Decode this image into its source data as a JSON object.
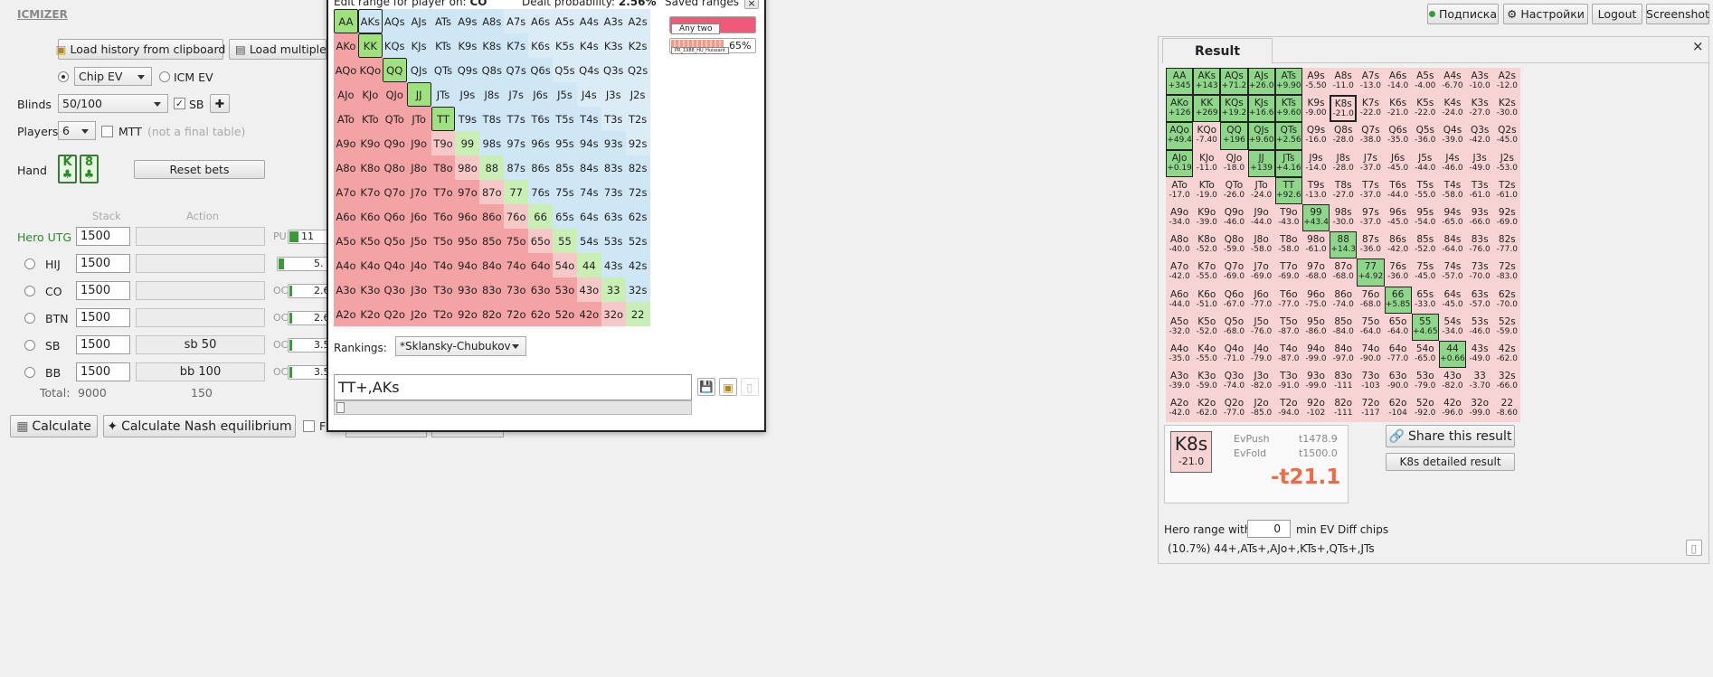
{
  "app": {
    "logo": "ICMIZER"
  },
  "topnav": {
    "subscription": "Подписка",
    "settings": "Настройки",
    "logout": "Logout",
    "screenshot": "Screenshot"
  },
  "left": {
    "load_history": "Load history from clipboard",
    "load_multiple": "Load multiple",
    "ev_mode": "Chip EV",
    "icm_ev": "ICM EV",
    "blinds_label": "Blinds",
    "blinds_value": "50/100",
    "sb_label": "SB",
    "players_label": "Players",
    "players_value": "6",
    "mtt_label": "MTT",
    "mtt_note": "(not a final table)",
    "hand_label": "Hand",
    "card1": "K",
    "card2": "8",
    "reset_bets": "Reset bets",
    "stack_header": "Stack",
    "action_header": "Action",
    "players": [
      {
        "name": "Hero",
        "pos": "UTG",
        "stack": "1500",
        "action": "",
        "chip": "PU",
        "range": "11"
      },
      {
        "name": "HIJ",
        "stack": "1500",
        "action": "",
        "chip": "",
        "range": "5."
      },
      {
        "name": "CO",
        "stack": "1500",
        "action": "",
        "chip": "OC",
        "range": "2.6"
      },
      {
        "name": "BTN",
        "stack": "1500",
        "action": "",
        "chip": "OC",
        "range": "2.6"
      },
      {
        "name": "SB",
        "stack": "1500",
        "action": "sb 50",
        "chip": "OC",
        "range": "3.5"
      },
      {
        "name": "BB",
        "stack": "1500",
        "action": "bb 100",
        "chip": "OC",
        "range": "3.5"
      }
    ],
    "total_label": "Total:",
    "total_stack": "9000",
    "total_action": "150",
    "calculate": "Calculate",
    "nash": "Calculate Nash equilibrium",
    "f_label": "F"
  },
  "editor": {
    "title": "Edit range for player on:",
    "title_pos": "CO",
    "dealt_label": "Dealt probability:",
    "dealt_value": "2.56%",
    "saved_label": "Saved ranges",
    "close": "×",
    "saved_any_two": "Any two",
    "saved_pct": "65%",
    "saved_thumb_caption": "PR_1988_HU_Huissant",
    "rankings_label": "Rankings:",
    "rankings_value": "*Sklansky-Chubukov",
    "range_text": "TT+,AKs"
  },
  "hands": [
    [
      "AA",
      "AKs",
      "AQs",
      "AJs",
      "ATs",
      "A9s",
      "A8s",
      "A7s",
      "A6s",
      "A5s",
      "A4s",
      "A3s",
      "A2s"
    ],
    [
      "AKo",
      "KK",
      "KQs",
      "KJs",
      "KTs",
      "K9s",
      "K8s",
      "K7s",
      "K6s",
      "K5s",
      "K4s",
      "K3s",
      "K2s"
    ],
    [
      "AQo",
      "KQo",
      "QQ",
      "QJs",
      "QTs",
      "Q9s",
      "Q8s",
      "Q7s",
      "Q6s",
      "Q5s",
      "Q4s",
      "Q3s",
      "Q2s"
    ],
    [
      "AJo",
      "KJo",
      "QJo",
      "JJ",
      "JTs",
      "J9s",
      "J8s",
      "J7s",
      "J6s",
      "J5s",
      "J4s",
      "J3s",
      "J2s"
    ],
    [
      "ATo",
      "KTo",
      "QTo",
      "JTo",
      "TT",
      "T9s",
      "T8s",
      "T7s",
      "T6s",
      "T5s",
      "T4s",
      "T3s",
      "T2s"
    ],
    [
      "A9o",
      "K9o",
      "Q9o",
      "J9o",
      "T9o",
      "99",
      "98s",
      "97s",
      "96s",
      "95s",
      "94s",
      "93s",
      "92s"
    ],
    [
      "A8o",
      "K8o",
      "Q8o",
      "J8o",
      "T8o",
      "98o",
      "88",
      "87s",
      "86s",
      "85s",
      "84s",
      "83s",
      "82s"
    ],
    [
      "A7o",
      "K7o",
      "Q7o",
      "J7o",
      "T7o",
      "97o",
      "87o",
      "77",
      "76s",
      "75s",
      "74s",
      "73s",
      "72s"
    ],
    [
      "A6o",
      "K6o",
      "Q6o",
      "J6o",
      "T6o",
      "96o",
      "86o",
      "76o",
      "66",
      "65s",
      "64s",
      "63s",
      "62s"
    ],
    [
      "A5o",
      "K5o",
      "Q5o",
      "J5o",
      "T5o",
      "95o",
      "85o",
      "75o",
      "65o",
      "55",
      "54s",
      "53s",
      "52s"
    ],
    [
      "A4o",
      "K4o",
      "Q4o",
      "J4o",
      "T4o",
      "94o",
      "84o",
      "74o",
      "64o",
      "54o",
      "44",
      "43s",
      "42s"
    ],
    [
      "A3o",
      "K3o",
      "Q3o",
      "J3o",
      "T3o",
      "93o",
      "83o",
      "73o",
      "63o",
      "53o",
      "43o",
      "33",
      "32s"
    ],
    [
      "A2o",
      "K2o",
      "Q2o",
      "J2o",
      "T2o",
      "92o",
      "82o",
      "72o",
      "62o",
      "52o",
      "42o",
      "32o",
      "22"
    ]
  ],
  "result": {
    "title": "Result",
    "close": "×",
    "ev": [
      [
        "+345",
        "+143",
        "+71.2",
        "+26.0",
        "+9.90",
        "-5.50",
        "-11.0",
        "-13.0",
        "-14.0",
        "-4.00",
        "-6.70",
        "-10.0",
        "-12.0"
      ],
      [
        "+126",
        "+269",
        "+19.2",
        "+16.6",
        "+9.60",
        "-9.00",
        "-21.0",
        "-22.0",
        "-21.0",
        "-22.0",
        "-24.0",
        "-27.0",
        "-30.0"
      ],
      [
        "+49.4",
        "-7.40",
        "+196",
        "+9.60",
        "+2.56",
        "-16.0",
        "-28.0",
        "-38.0",
        "-35.0",
        "-36.0",
        "-39.0",
        "-42.0",
        "-45.0"
      ],
      [
        "+0.19",
        "-11.0",
        "-18.0",
        "+139",
        "+4.16",
        "-14.0",
        "-28.0",
        "-37.0",
        "-45.0",
        "-44.0",
        "-46.0",
        "-49.0",
        "-53.0"
      ],
      [
        "-17.0",
        "-19.0",
        "-26.0",
        "-24.0",
        "+92.6",
        "-13.0",
        "-27.0",
        "-37.0",
        "-44.0",
        "-55.0",
        "-58.0",
        "-61.0",
        "-61.0"
      ],
      [
        "-34.0",
        "-39.0",
        "-46.0",
        "-44.0",
        "-43.0",
        "+43.4",
        "-30.0",
        "-37.0",
        "-45.0",
        "-54.0",
        "-65.0",
        "-66.0",
        "-69.0"
      ],
      [
        "-40.0",
        "-52.0",
        "-59.0",
        "-58.0",
        "-58.0",
        "-61.0",
        "+14.3",
        "-36.0",
        "-42.0",
        "-52.0",
        "-64.0",
        "-76.0",
        "-77.0"
      ],
      [
        "-42.0",
        "-55.0",
        "-69.0",
        "-69.0",
        "-69.0",
        "-68.0",
        "-68.0",
        "+4.92",
        "-36.0",
        "-45.0",
        "-57.0",
        "-70.0",
        "-83.0"
      ],
      [
        "-44.0",
        "-51.0",
        "-67.0",
        "-77.0",
        "-77.0",
        "-75.0",
        "-74.0",
        "-68.0",
        "+5.85",
        "-33.0",
        "-45.0",
        "-57.0",
        "-70.0"
      ],
      [
        "-32.0",
        "-52.0",
        "-68.0",
        "-76.0",
        "-87.0",
        "-86.0",
        "-84.0",
        "-64.0",
        "-64.0",
        "+4.65",
        "-34.0",
        "-46.0",
        "-59.0"
      ],
      [
        "-35.0",
        "-55.0",
        "-71.0",
        "-79.0",
        "-87.0",
        "-99.0",
        "-97.0",
        "-90.0",
        "-77.0",
        "-65.0",
        "+0.66",
        "-49.0",
        "-62.0"
      ],
      [
        "-39.0",
        "-59.0",
        "-74.0",
        "-82.0",
        "-91.0",
        "-99.0",
        "-111",
        "-103",
        "-90.0",
        "-79.0",
        "-82.0",
        "-3.70",
        "-66.0"
      ],
      [
        "-42.0",
        "-62.0",
        "-77.0",
        "-85.0",
        "-94.0",
        "-102",
        "-111",
        "-117",
        "-104",
        "-92.0",
        "-96.0",
        "-99.0",
        "-8.60"
      ]
    ],
    "selected_hand": "K8s",
    "selected_ev": "-21.0",
    "evpush_label": "EvPush",
    "evpush_value": "t1478.9",
    "evfold_label": "EvFold",
    "evfold_value": "t1500.0",
    "diff": "-t21.1",
    "share": "Share this result",
    "detailed": "K8s detailed result",
    "hero_range_label": "Hero range with",
    "min_ev_value": "0",
    "min_ev_label": "min EV Diff chips",
    "hero_range_text": "(10.7%) 44+,ATs+,AJo+,KTs+,QTs+,JTs"
  }
}
